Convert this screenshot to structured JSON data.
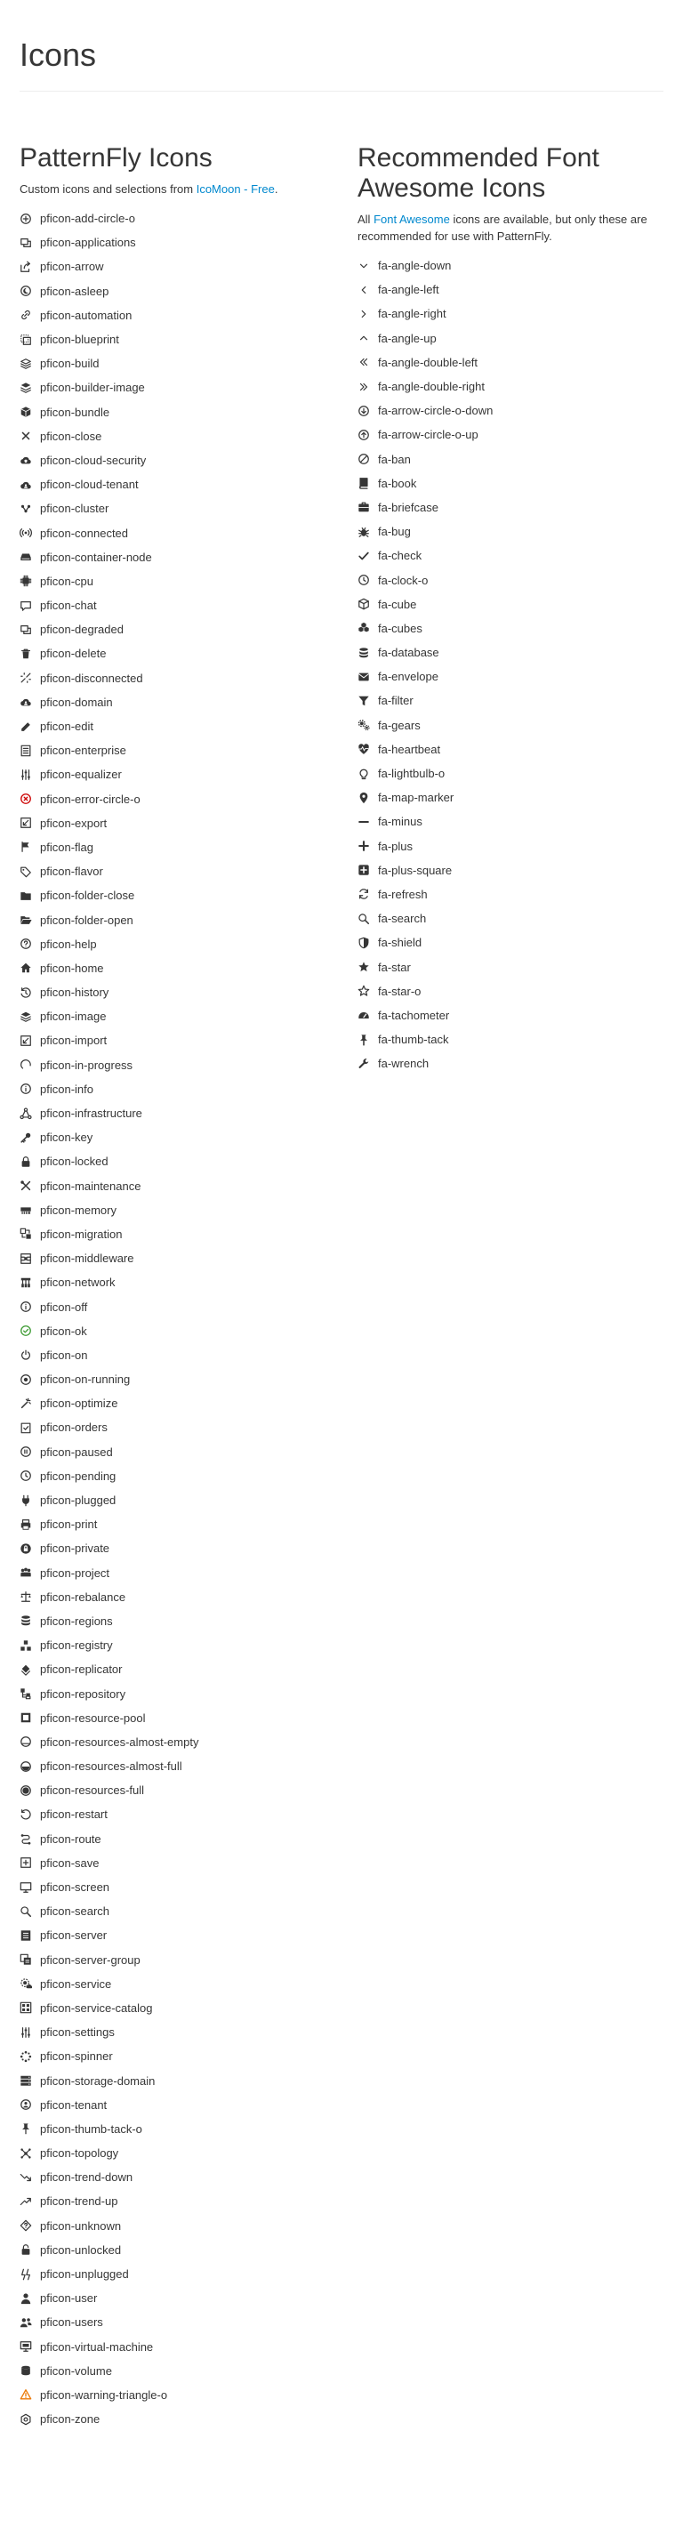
{
  "page": {
    "title": "Icons"
  },
  "patternfly": {
    "title": "PatternFly Icons",
    "intro_prefix": "Custom icons and selections from ",
    "intro_link": "IcoMoon - Free",
    "intro_suffix": ".",
    "icons": [
      "pficon-add-circle-o",
      "pficon-applications",
      "pficon-arrow",
      "pficon-asleep",
      "pficon-automation",
      "pficon-blueprint",
      "pficon-build",
      "pficon-builder-image",
      "pficon-bundle",
      "pficon-close",
      "pficon-cloud-security",
      "pficon-cloud-tenant",
      "pficon-cluster",
      "pficon-connected",
      "pficon-container-node",
      "pficon-cpu",
      "pficon-chat",
      "pficon-degraded",
      "pficon-delete",
      "pficon-disconnected",
      "pficon-domain",
      "pficon-edit",
      "pficon-enterprise",
      "pficon-equalizer",
      "pficon-error-circle-o",
      "pficon-export",
      "pficon-flag",
      "pficon-flavor",
      "pficon-folder-close",
      "pficon-folder-open",
      "pficon-help",
      "pficon-home",
      "pficon-history",
      "pficon-image",
      "pficon-import",
      "pficon-in-progress",
      "pficon-info",
      "pficon-infrastructure",
      "pficon-key",
      "pficon-locked",
      "pficon-maintenance",
      "pficon-memory",
      "pficon-migration",
      "pficon-middleware",
      "pficon-network",
      "pficon-off",
      "pficon-ok",
      "pficon-on",
      "pficon-on-running",
      "pficon-optimize",
      "pficon-orders",
      "pficon-paused",
      "pficon-pending",
      "pficon-plugged",
      "pficon-print",
      "pficon-private",
      "pficon-project",
      "pficon-rebalance",
      "pficon-regions",
      "pficon-registry",
      "pficon-replicator",
      "pficon-repository",
      "pficon-resource-pool",
      "pficon-resources-almost-empty",
      "pficon-resources-almost-full",
      "pficon-resources-full",
      "pficon-restart",
      "pficon-route",
      "pficon-save",
      "pficon-screen",
      "pficon-search",
      "pficon-server",
      "pficon-server-group",
      "pficon-service",
      "pficon-service-catalog",
      "pficon-settings",
      "pficon-spinner",
      "pficon-storage-domain",
      "pficon-tenant",
      "pficon-thumb-tack-o",
      "pficon-topology",
      "pficon-trend-down",
      "pficon-trend-up",
      "pficon-unknown",
      "pficon-unlocked",
      "pficon-unplugged",
      "pficon-user",
      "pficon-users",
      "pficon-virtual-machine",
      "pficon-volume",
      "pficon-warning-triangle-o",
      "pficon-zone"
    ]
  },
  "fontawesome": {
    "title": "Recommended Font Awesome Icons",
    "intro_prefix": "All ",
    "intro_link": "Font Awesome",
    "intro_suffix": " icons are available, but only these are recommended for use with PatternFly.",
    "icons": [
      "fa-angle-down",
      "fa-angle-left",
      "fa-angle-right",
      "fa-angle-up",
      "fa-angle-double-left",
      "fa-angle-double-right",
      "fa-arrow-circle-o-down",
      "fa-arrow-circle-o-up",
      "fa-ban",
      "fa-book",
      "fa-briefcase",
      "fa-bug",
      "fa-check",
      "fa-clock-o",
      "fa-cube",
      "fa-cubes",
      "fa-database",
      "fa-envelope",
      "fa-filter",
      "fa-gears",
      "fa-heartbeat",
      "fa-lightbulb-o",
      "fa-map-marker",
      "fa-minus",
      "fa-plus",
      "fa-plus-square",
      "fa-refresh",
      "fa-search",
      "fa-shield",
      "fa-star",
      "fa-star-o",
      "fa-tachometer",
      "fa-thumb-tack",
      "fa-wrench"
    ]
  },
  "colors": {
    "text": "#363636",
    "link": "#0088ce",
    "ok": "#3f9c35",
    "error": "#cc0000",
    "warning": "#ec7a08"
  }
}
